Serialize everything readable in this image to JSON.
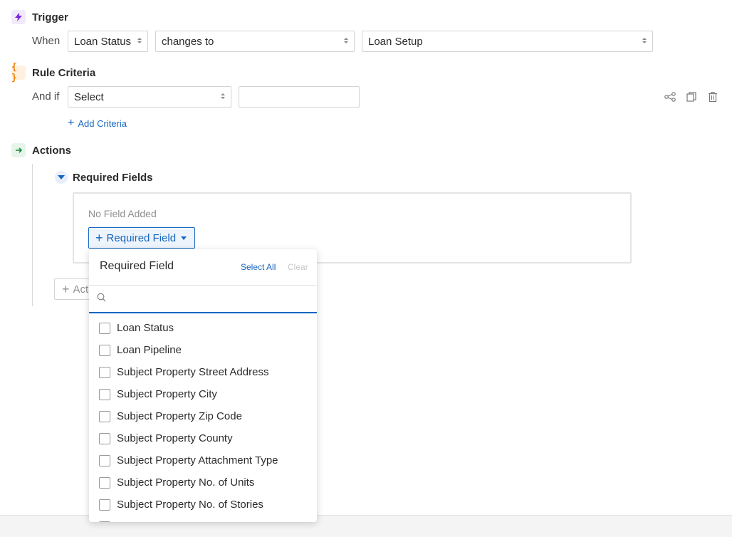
{
  "trigger": {
    "title": "Trigger",
    "when_label": "When",
    "field_select": "Loan Status",
    "operator_select": "changes to",
    "value_select": "Loan Setup",
    "icon": "lightning-icon",
    "icon_color": "#7b2cd6"
  },
  "criteria": {
    "title": "Rule Criteria",
    "and_if_label": "And if",
    "field_select": "Select",
    "value_input": "",
    "add_criteria": "Add Criteria",
    "icon": "braces-icon",
    "icon_color": "#f07c00"
  },
  "actions": {
    "title": "Actions",
    "icon": "arrow-right-icon",
    "icon_color": "#1a8a3a",
    "required_fields": {
      "title": "Required Fields",
      "empty_text": "No Field Added",
      "button_label": "Required Field"
    },
    "add_action_label": "Act"
  },
  "toolbar": {
    "icons": [
      "share-icon",
      "copy-icon",
      "trash-icon"
    ]
  },
  "dropdown": {
    "title": "Required Field",
    "select_all": "Select All",
    "clear": "Clear",
    "search_value": "",
    "items": [
      {
        "label": "Loan Status",
        "checked": false
      },
      {
        "label": "Loan Pipeline",
        "checked": false
      },
      {
        "label": "Subject Property Street Address",
        "checked": false
      },
      {
        "label": "Subject Property City",
        "checked": false
      },
      {
        "label": "Subject Property Zip Code",
        "checked": false
      },
      {
        "label": "Subject Property County",
        "checked": false
      },
      {
        "label": "Subject Property Attachment Type",
        "checked": false
      },
      {
        "label": "Subject Property No. of Units",
        "checked": false
      },
      {
        "label": "Subject Property No. of Stories",
        "checked": false
      }
    ]
  },
  "colors": {
    "accent": "#1565c0"
  }
}
